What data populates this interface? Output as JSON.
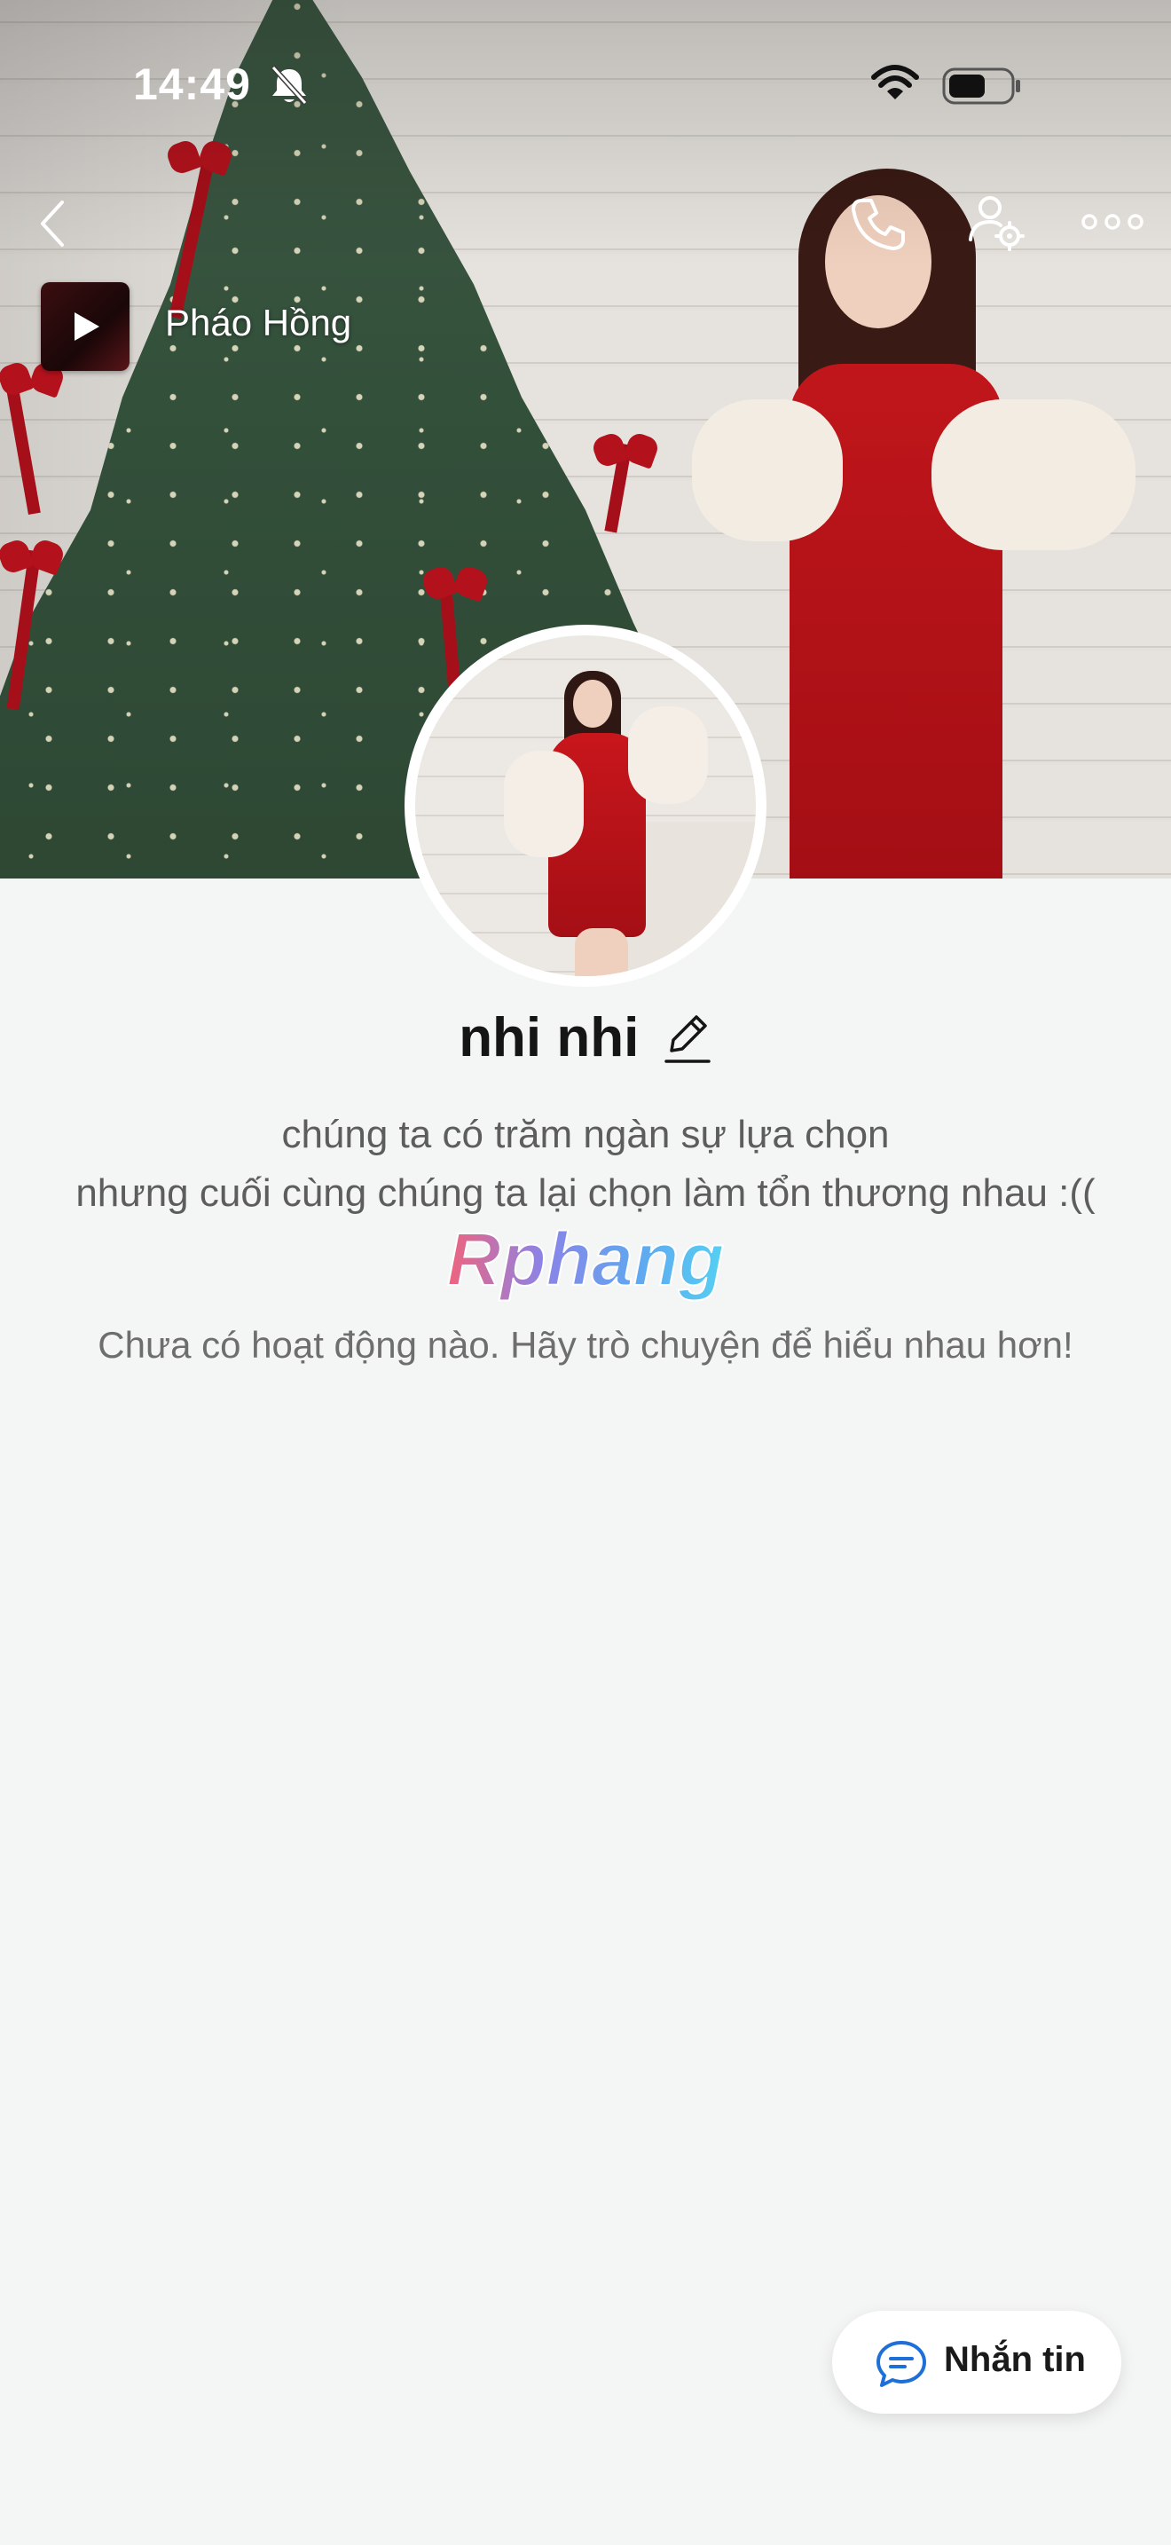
{
  "status_bar": {
    "time": "14:49",
    "silent_icon": "bell-slash-icon",
    "wifi_icon": "wifi-icon",
    "battery_icon": "battery-icon"
  },
  "header": {
    "back_icon": "chevron-left-icon",
    "call_icon": "phone-icon",
    "settings_icon": "user-settings-icon",
    "more_icon": "more-horizontal-icon"
  },
  "music": {
    "title": "Pháo Hồng",
    "play_icon": "play-icon"
  },
  "profile": {
    "name": "nhi nhi",
    "edit_icon": "pencil-icon",
    "bio_line_1": "chúng ta có trăm ngàn sự lựa chọn",
    "bio_line_2": "nhưng cuối cùng chúng ta lại chọn làm tổn thương nhau :((",
    "watermark": "Rphang",
    "empty_activity": "Chưa có hoạt động nào. Hãy trò chuyện để hiểu nhau hơn!"
  },
  "actions": {
    "message_label": "Nhắn tin",
    "message_icon": "chat-bubble-icon"
  },
  "colors": {
    "background": "#f4f5f5",
    "message_icon": "#1f6fd8"
  }
}
